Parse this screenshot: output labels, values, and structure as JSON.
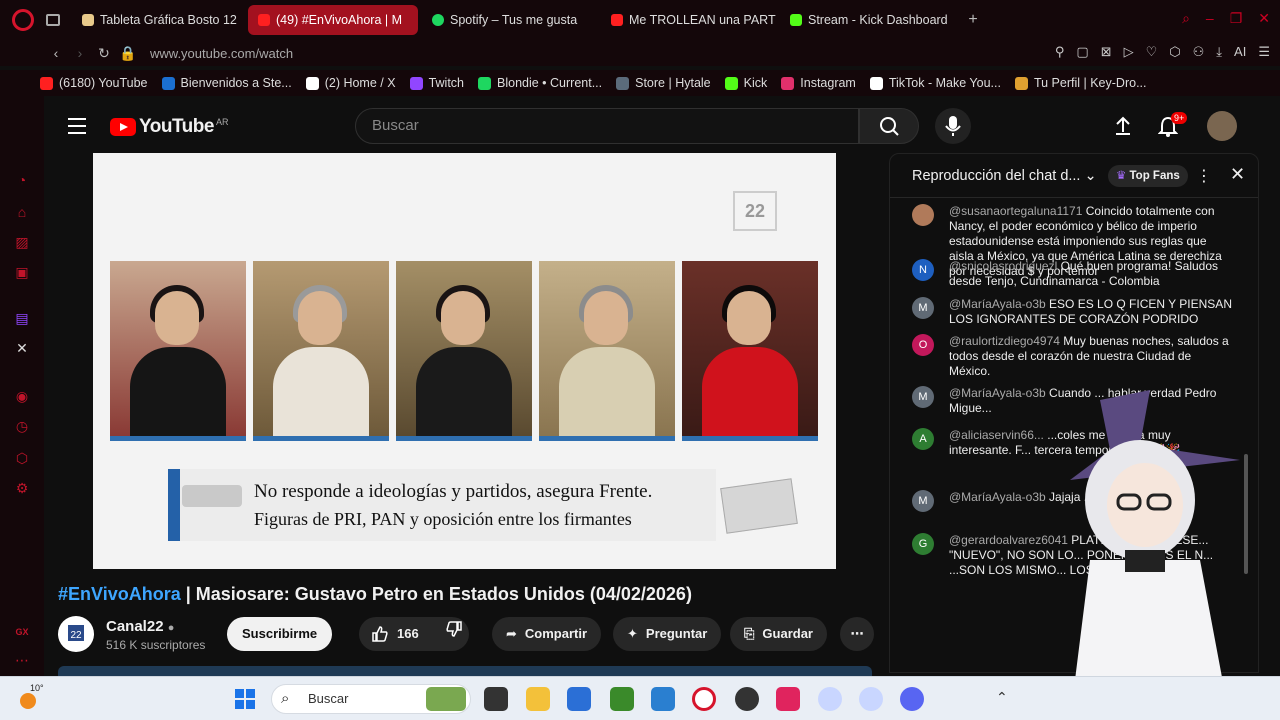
{
  "browser": {
    "tabs": [
      {
        "label": "Tableta Gráfica Bosto 12",
        "color": "#e8c98a"
      },
      {
        "label": "(49) #EnVivoAhora | M",
        "color": "#ff2020",
        "active": true
      },
      {
        "label": "Spotify – Tus me gusta",
        "color": "#1ed760"
      },
      {
        "label": "Me TROLLEAN una PARTI",
        "color": "#ff2020"
      },
      {
        "label": "Stream - Kick Dashboard",
        "color": "#53fc18"
      }
    ],
    "new_tab": "+",
    "url": "www.youtube.com/watch",
    "address_ai_label": "AI",
    "bookmarks": [
      {
        "label": "(6180) YouTube",
        "color": "#ff2020"
      },
      {
        "label": "Bienvenidos a Ste...",
        "color": "#1b6fd1"
      },
      {
        "label": "(2) Home / X",
        "color": "#ffffff"
      },
      {
        "label": "Twitch",
        "color": "#9146ff"
      },
      {
        "label": "Blondie • Current...",
        "color": "#1ed760"
      },
      {
        "label": "Store | Hytale",
        "color": "#5b6b7b"
      },
      {
        "label": "Kick",
        "color": "#53fc18"
      },
      {
        "label": "Instagram",
        "color": "#e1306c"
      },
      {
        "label": "TikTok - Make You...",
        "color": "#ffffff"
      },
      {
        "label": "Tu Perfil | Key-Dro...",
        "color": "#e0a030"
      }
    ],
    "sidebar_bottom_label": "GX"
  },
  "youtube": {
    "logo_text": "YouTube",
    "country_code": "AR",
    "search_placeholder": "Buscar",
    "notif_count": "9+",
    "video": {
      "channel_bug": "22",
      "caption_line1": "No responde a ideologías y partidos, asegura Frente.",
      "caption_line2": "Figuras de PRI, PAN y oposición entre los firmantes"
    },
    "title_tag": "#EnVivoAhora",
    "title_rest": " | Masiosare: Gustavo Petro en Estados Unidos (04/02/2026)",
    "channel_name": "Canal22",
    "channel_subs": "516 K suscriptores",
    "subscribe_label": "Suscribirme",
    "likes": "166",
    "share_label": "Compartir",
    "ask_label": "Preguntar",
    "save_label": "Guardar"
  },
  "chat": {
    "title": "Reproducción del chat d...",
    "top_fans": "Top Fans",
    "messages": [
      {
        "initial": "",
        "color": "#b07a5a",
        "user": "@susanaortegaluna1171",
        "text": "Coincido totalmente con Nancy, el poder económico y bélico de imperio estadounidense está imponiendo sus reglas que aisla a México, ya que América Latina se derechiza por necesidad $ y por temor"
      },
      {
        "initial": "N",
        "color": "#1e5fc0",
        "user": "@snicolasrodriguezl",
        "text": "Qué buen programa! Saludos desde Tenjo, Cundinamarca - Colombia"
      },
      {
        "initial": "M",
        "color": "#606a75",
        "user": "@MaríaAyala-o3b",
        "text": "ESO ES LO Q FICEN Y PIENSAN LOS IGNORANTES DE CORAZÓN PODRIDO"
      },
      {
        "initial": "O",
        "color": "#c2185b",
        "user": "@raulortizdiego4974",
        "text": "Muy buenas noches, saludos a todos desde el corazón de nuestra Ciudad de México."
      },
      {
        "initial": "M",
        "color": "#606a75",
        "user": "@MaríaAyala-o3b",
        "text": "Cuando ... hablar verdad Pedro Migue..."
      },
      {
        "initial": "A",
        "color": "#2e7d32",
        "user": "@aliciaservin66...",
        "text": "...coles me resulta muy interesante. F... tercera temporada 🎉🎉🎉"
      },
      {
        "initial": "M",
        "color": "#606a75",
        "user": "@MaríaAyala-o3b",
        "text": "Jajaja ... siempre 🤣😂🤣"
      },
      {
        "initial": "G",
        "color": "#2e7d32",
        "user": "@gerardoalvarez6041",
        "text": "PLATILLOS EN PRESE... \"NUEVO\", NO SON LO... PONEN, NO ES EL N... ...SON LOS MISMO... LOS MISMOS AB..."
      }
    ]
  },
  "taskbar": {
    "weather_temp": "10°",
    "search_placeholder": "Buscar"
  }
}
